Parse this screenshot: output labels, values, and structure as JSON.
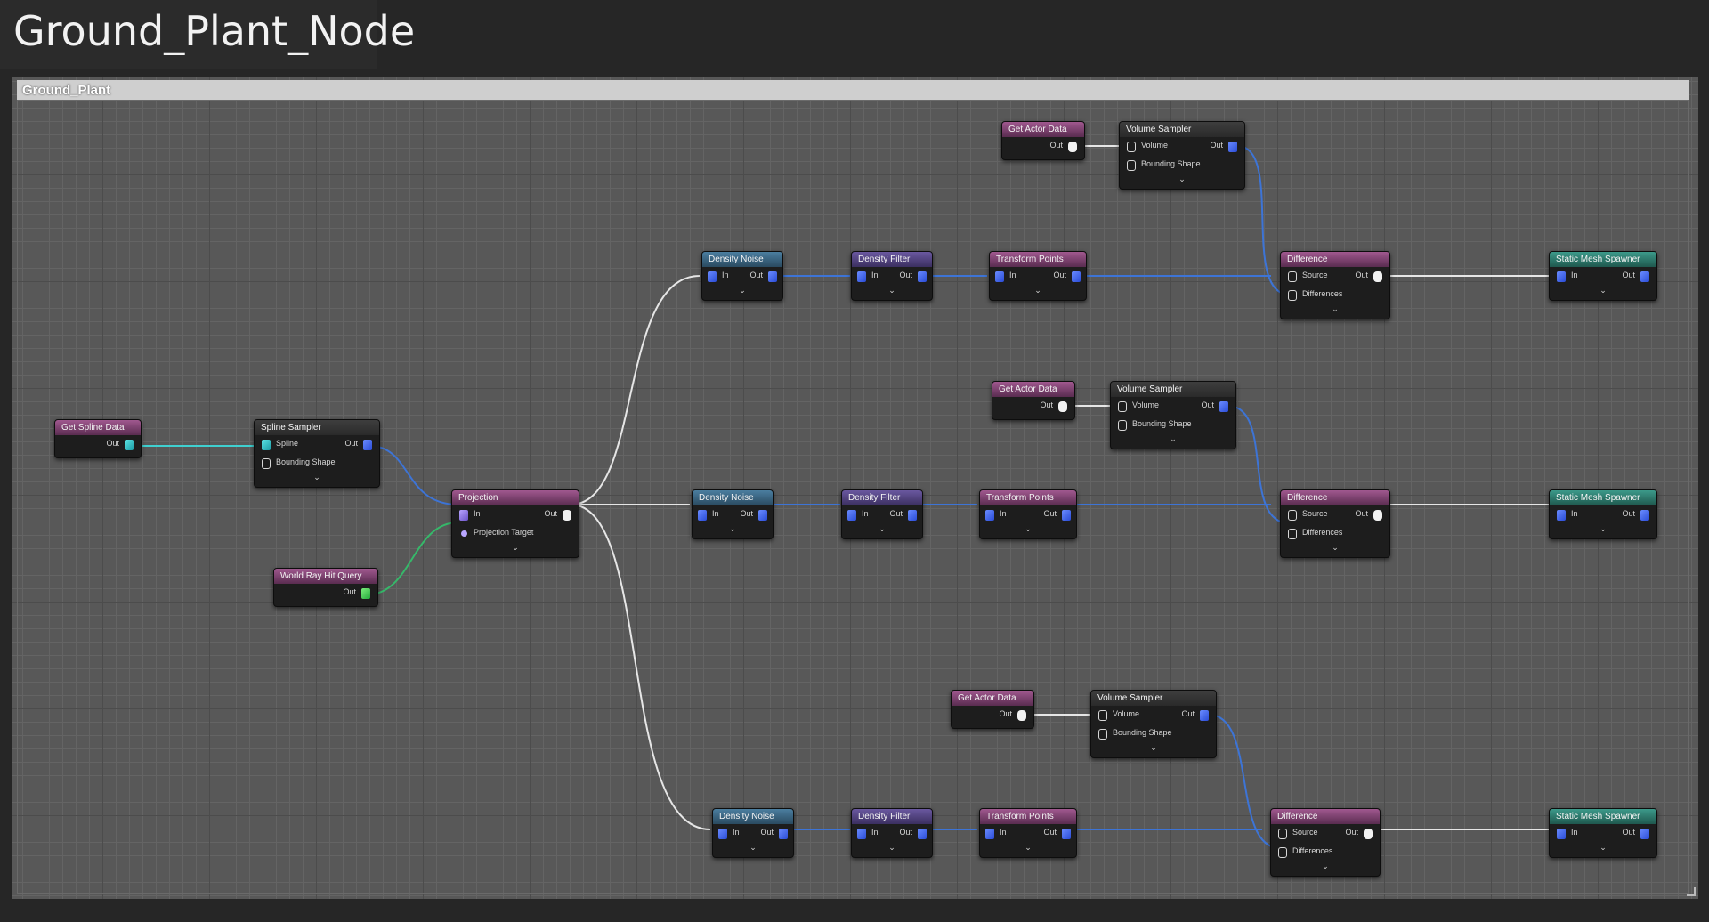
{
  "page": {
    "title": "Ground_Plant_Node"
  },
  "comment": {
    "title": "Ground_Plant"
  },
  "labels": {
    "out": "Out",
    "in": "In",
    "spline": "Spline",
    "bounding_shape": "Bounding Shape",
    "projection_target": "Projection Target",
    "volume": "Volume",
    "source": "Source",
    "differences": "Differences"
  },
  "nodes": {
    "get_spline_data": "Get Spline Data",
    "spline_sampler": "Spline Sampler",
    "world_ray_hit_query": "World Ray Hit Query",
    "projection": "Projection",
    "density_noise": "Density Noise",
    "density_filter": "Density Filter",
    "transform_points": "Transform Points",
    "get_actor_data": "Get Actor Data",
    "volume_sampler": "Volume Sampler",
    "difference": "Difference",
    "static_mesh_spawner": "Static Mesh Spawner"
  },
  "colors": {
    "wire_blue": "#3d74d6",
    "wire_white": "#e6e6e6",
    "wire_teal": "#3fd0d0",
    "wire_green": "#36b86a"
  }
}
